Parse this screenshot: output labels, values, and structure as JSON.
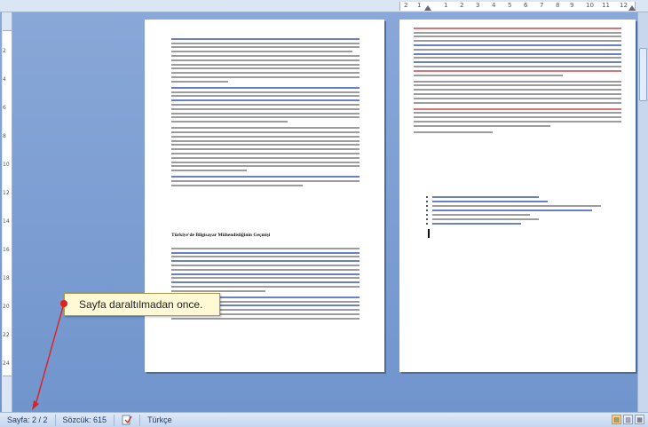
{
  "ruler": {
    "h_labels": [
      "2",
      "1",
      "1",
      "2",
      "3",
      "4",
      "5",
      "6",
      "7",
      "8",
      "9",
      "10",
      "11",
      "12"
    ],
    "v_labels": [
      "2",
      "4",
      "6",
      "8",
      "10",
      "12",
      "14",
      "16",
      "18",
      "20",
      "22",
      "24"
    ]
  },
  "document": {
    "page1": {
      "heading1": "Türkiye'de Bilgisayar Mühendisliğinin Geçmişi"
    }
  },
  "callout": {
    "text": "Sayfa daraltılmadan once."
  },
  "statusbar": {
    "page_label": "Sayfa: 2 / 2",
    "word_count": "Sözcük: 615",
    "language": "Türkçe",
    "spellcheck_icon": "spellcheck-icon"
  }
}
